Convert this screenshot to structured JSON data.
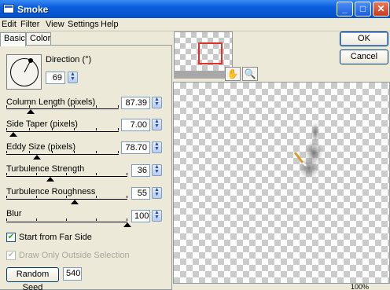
{
  "window": {
    "title": "Smoke",
    "buttons": {
      "minimize": "_",
      "maximize": "□",
      "close": "✕"
    }
  },
  "menu": [
    "Edit",
    "Filter",
    "View",
    "Settings",
    "Help"
  ],
  "tabs": [
    {
      "label": "Basic",
      "active": true
    },
    {
      "label": "Color",
      "active": false
    }
  ],
  "direction": {
    "label": "Direction (°)",
    "value": "69"
  },
  "sliders": [
    {
      "label": "Column Length (pixels)",
      "value": "87.39"
    },
    {
      "label": "Side Taper (pixels)",
      "value": "7.00"
    },
    {
      "label": "Eddy Size (pixels)",
      "value": "78.70"
    },
    {
      "label": "Turbulence Strength",
      "value": "36"
    },
    {
      "label": "Turbulence Roughness",
      "value": "55"
    },
    {
      "label": "Blur",
      "value": "100"
    }
  ],
  "options": {
    "start_far_side": {
      "label": "Start from Far Side",
      "checked": true
    },
    "draw_outside": {
      "label": "Draw Only Outside Selection",
      "checked": true,
      "disabled": true
    }
  },
  "random_seed": {
    "button": "Random Seed",
    "value": "540"
  },
  "dialog_buttons": {
    "ok": "OK",
    "cancel": "Cancel"
  },
  "zoom": "100%",
  "icons": {
    "hand": "hand-icon",
    "zoom": "magnifier-icon"
  }
}
